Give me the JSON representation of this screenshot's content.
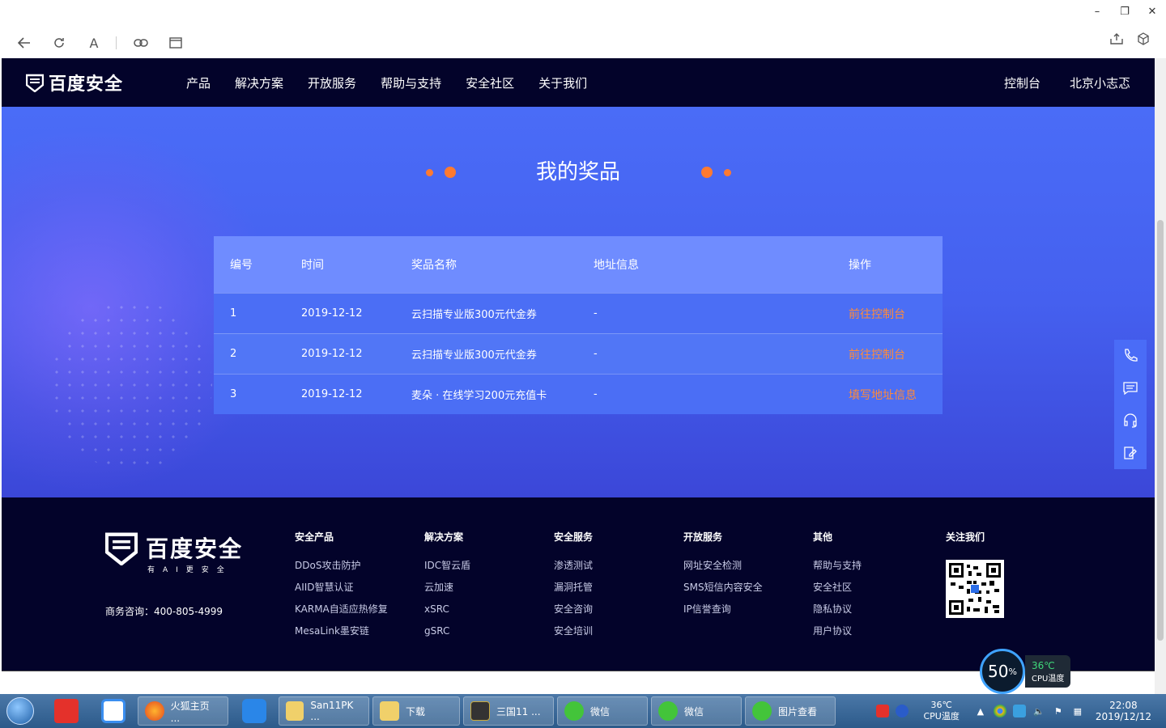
{
  "browser": {
    "window_controls": {
      "minimize": "–",
      "restore": "❐",
      "close": "✕"
    },
    "toolbar": {
      "font_glyph": "A"
    }
  },
  "site": {
    "logo_text": "百度安全",
    "nav": [
      "产品",
      "解决方案",
      "开放服务",
      "帮助与支持",
      "安全社区",
      "关于我们"
    ],
    "nav_right": {
      "console": "控制台",
      "user": "北京小志忑"
    }
  },
  "page": {
    "title": "我的奖品",
    "table": {
      "headers": [
        "编号",
        "时间",
        "奖品名称",
        "地址信息",
        "操作"
      ],
      "rows": [
        {
          "id": "1",
          "date": "2019-12-12",
          "name": "云扫描专业版300元代金券",
          "address": "-",
          "action": "前往控制台"
        },
        {
          "id": "2",
          "date": "2019-12-12",
          "name": "云扫描专业版300元代金券",
          "address": "-",
          "action": "前往控制台"
        },
        {
          "id": "3",
          "date": "2019-12-12",
          "name": "麦朵 · 在线学习200元充值卡",
          "address": "-",
          "action": "填写地址信息"
        }
      ]
    }
  },
  "footer": {
    "brand": "百度安全",
    "slogan": "有AI更安全",
    "phone": "商务咨询：400-805-4999",
    "columns": [
      {
        "title": "安全产品",
        "items": [
          "DDoS攻击防护",
          "AIID智慧认证",
          "KARMA自适应热修复",
          "MesaLink墨安链"
        ]
      },
      {
        "title": "解决方案",
        "items": [
          "IDC智云盾",
          "云加速",
          "xSRC",
          "gSRC"
        ]
      },
      {
        "title": "安全服务",
        "items": [
          "渗透测试",
          "漏洞托管",
          "安全咨询",
          "安全培训"
        ]
      },
      {
        "title": "开放服务",
        "items": [
          "网址安全检测",
          "SMS短信内容安全",
          "IP信誉查询"
        ]
      },
      {
        "title": "其他",
        "items": [
          "帮助与支持",
          "安全社区",
          "隐私协议",
          "用户协议"
        ]
      }
    ],
    "follow_title": "关注我们"
  },
  "cpu_widget": {
    "percent": "50",
    "percent_unit": "%",
    "temp": "36℃",
    "label": "CPU温度"
  },
  "taskbar": {
    "tasks": [
      "火狐主页 ...",
      "San11PK ...",
      "下载",
      "三国11 ...",
      "微信",
      "微信",
      "图片查看"
    ],
    "tray_temp": "36℃",
    "tray_temp_label": "CPU温度",
    "time": "22:08",
    "date": "2019/12/12"
  },
  "colors": {
    "accent": "#4a6cf7",
    "nav_bg": "#03032a",
    "action": "#ff8a3a"
  }
}
